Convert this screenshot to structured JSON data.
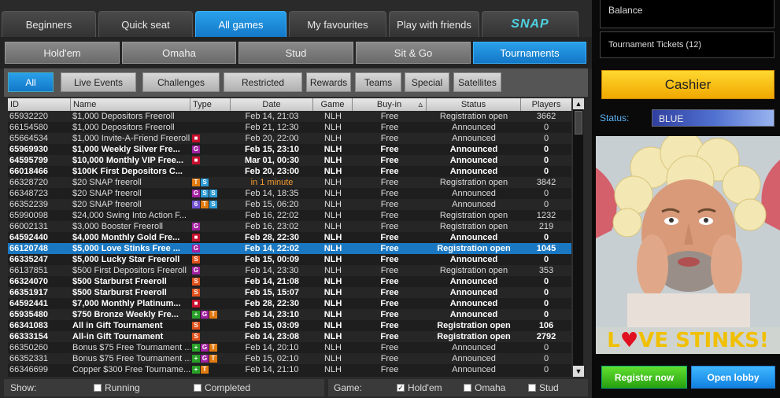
{
  "top_tabs": [
    {
      "label": "Beginners"
    },
    {
      "label": "Quick seat"
    },
    {
      "label": "All games"
    },
    {
      "label": "My favourites"
    },
    {
      "label": "Play with friends"
    },
    {
      "label": "SNAP"
    }
  ],
  "game_tabs": [
    {
      "label": "Hold'em"
    },
    {
      "label": "Omaha"
    },
    {
      "label": "Stud"
    },
    {
      "label": "Sit & Go"
    },
    {
      "label": "Tournaments"
    }
  ],
  "filter_tabs": [
    {
      "label": "All"
    },
    {
      "label": "Live Events"
    },
    {
      "label": "Challenges"
    },
    {
      "label": "Restricted"
    },
    {
      "label": "Rewards"
    },
    {
      "label": "Teams"
    },
    {
      "label": "Special"
    },
    {
      "label": "Satellites"
    }
  ],
  "table": {
    "headers": [
      "ID",
      "Name",
      "Type",
      "Date",
      "Game",
      "Buy-in",
      "Status",
      "Players"
    ],
    "rows": [
      {
        "id": "65932220",
        "name": "$1,000 Depositors Freeroll",
        "type": "",
        "date": "Feb 14, 21:03",
        "game": "NLH",
        "buyin": "Free",
        "status": "Registration open",
        "players": "3662",
        "style": ""
      },
      {
        "id": "66154580",
        "name": "$1,000 Depositors Freeroll",
        "type": "",
        "date": "Feb 21, 12:30",
        "game": "NLH",
        "buyin": "Free",
        "status": "Announced",
        "players": "0",
        "style": ""
      },
      {
        "id": "65664534",
        "name": "$1,000 Invite-A-Friend Freeroll",
        "type": "lock",
        "date": "Feb 20, 22:00",
        "game": "NLH",
        "buyin": "Free",
        "status": "Announced",
        "players": "0",
        "style": ""
      },
      {
        "id": "65969930",
        "name": "$1,000 Weekly Silver Fre...",
        "type": "G",
        "date": "Feb 15, 23:10",
        "game": "NLH",
        "buyin": "Free",
        "status": "Announced",
        "players": "0",
        "style": "bold"
      },
      {
        "id": "64595799",
        "name": "$10,000 Monthly VIP Free...",
        "type": "lock",
        "date": "Mar 01, 00:30",
        "game": "NLH",
        "buyin": "Free",
        "status": "Announced",
        "players": "0",
        "style": "bold"
      },
      {
        "id": "66018466",
        "name": "$100K First Depositors C...",
        "type": "",
        "date": "Feb 20, 23:00",
        "game": "NLH",
        "buyin": "Free",
        "status": "Announced",
        "players": "0",
        "style": "bold"
      },
      {
        "id": "66328720",
        "name": "$20 SNAP freeroll",
        "type": "T S",
        "date": "in 1 minute",
        "game": "NLH",
        "buyin": "Free",
        "status": "Registration open",
        "players": "3842",
        "style": "",
        "date_style": "orange"
      },
      {
        "id": "66348723",
        "name": "$20 SNAP freeroll",
        "type": "G S S",
        "date": "Feb 14, 18:35",
        "game": "NLH",
        "buyin": "Free",
        "status": "Announced",
        "players": "0",
        "style": ""
      },
      {
        "id": "66352239",
        "name": "$20 SNAP freeroll",
        "type": "6 T S",
        "date": "Feb 15, 06:20",
        "game": "NLH",
        "buyin": "Free",
        "status": "Announced",
        "players": "0",
        "style": ""
      },
      {
        "id": "65990098",
        "name": "$24,000 Swing Into Action F...",
        "type": "",
        "date": "Feb 16, 22:02",
        "game": "NLH",
        "buyin": "Free",
        "status": "Registration open",
        "players": "1232",
        "style": ""
      },
      {
        "id": "66002131",
        "name": "$3,000 Booster Freeroll",
        "type": "G",
        "date": "Feb 16, 23:02",
        "game": "NLH",
        "buyin": "Free",
        "status": "Registration open",
        "players": "219",
        "style": ""
      },
      {
        "id": "64592440",
        "name": "$4,000 Monthly Gold Fre...",
        "type": "lock",
        "date": "Feb 28, 22:30",
        "game": "NLH",
        "buyin": "Free",
        "status": "Announced",
        "players": "0",
        "style": "bold"
      },
      {
        "id": "66120748",
        "name": "$5,000 Love Stinks Free ...",
        "type": "G",
        "date": "Feb 14, 22:02",
        "game": "NLH",
        "buyin": "Free",
        "status": "Registration open",
        "players": "1045",
        "style": "sel"
      },
      {
        "id": "66335247",
        "name": "$5,000 Lucky Star Freeroll",
        "type": "ST",
        "date": "Feb 15, 00:09",
        "game": "NLH",
        "buyin": "Free",
        "status": "Announced",
        "players": "0",
        "style": "bold"
      },
      {
        "id": "66137851",
        "name": "$500 First Depositors Freeroll",
        "type": "G",
        "date": "Feb 14, 23:30",
        "game": "NLH",
        "buyin": "Free",
        "status": "Registration open",
        "players": "353",
        "style": ""
      },
      {
        "id": "66324070",
        "name": "$500 Starburst Freeroll",
        "type": "ST",
        "date": "Feb 14, 21:08",
        "game": "NLH",
        "buyin": "Free",
        "status": "Announced",
        "players": "0",
        "style": "bold"
      },
      {
        "id": "66351917",
        "name": "$500 Starburst Freeroll",
        "type": "ST",
        "date": "Feb 15, 15:07",
        "game": "NLH",
        "buyin": "Free",
        "status": "Announced",
        "players": "0",
        "style": "bold"
      },
      {
        "id": "64592441",
        "name": "$7,000 Monthly Platinum...",
        "type": "lock",
        "date": "Feb 28, 22:30",
        "game": "NLH",
        "buyin": "Free",
        "status": "Announced",
        "players": "0",
        "style": "bold"
      },
      {
        "id": "65935480",
        "name": "$750 Bronze Weekly Fre...",
        "type": "+ G T",
        "date": "Feb 14, 23:10",
        "game": "NLH",
        "buyin": "Free",
        "status": "Announced",
        "players": "0",
        "style": "bold"
      },
      {
        "id": "66341083",
        "name": "All in Gift Tournament",
        "type": "ST",
        "date": "Feb 15, 03:09",
        "game": "NLH",
        "buyin": "Free",
        "status": "Registration open",
        "players": "106",
        "style": "bold"
      },
      {
        "id": "66333154",
        "name": "All-in Gift Tournament",
        "type": "ST",
        "date": "Feb 14, 23:08",
        "game": "NLH",
        "buyin": "Free",
        "status": "Registration open",
        "players": "2792",
        "style": "bold"
      },
      {
        "id": "66350260",
        "name": "Bonus $75 Free Tournament ...",
        "type": "+ G T",
        "date": "Feb 14, 20:10",
        "game": "NLH",
        "buyin": "Free",
        "status": "Announced",
        "players": "0",
        "style": ""
      },
      {
        "id": "66352331",
        "name": "Bonus $75 Free Tournament ...",
        "type": "+ G T",
        "date": "Feb 15, 02:10",
        "game": "NLH",
        "buyin": "Free",
        "status": "Announced",
        "players": "0",
        "style": ""
      },
      {
        "id": "66346699",
        "name": "Copper $300 Free Tourname...",
        "type": "+ T",
        "date": "Feb 14, 21:10",
        "game": "NLH",
        "buyin": "Free",
        "status": "Announced",
        "players": "0",
        "style": ""
      }
    ]
  },
  "bottom": {
    "show_label": "Show:",
    "running_label": "Running",
    "completed_label": "Completed",
    "game_label": "Game:",
    "holdem_label": "Hold'em",
    "omaha_label": "Omaha",
    "stud_label": "Stud"
  },
  "sidebar": {
    "balance_label": "Balance",
    "tickets_label": "Tournament Tickets (12)",
    "cashier_label": "Cashier",
    "status_label": "Status:",
    "status_value": "BLUE",
    "ad_text_1": "L",
    "ad_text_2": "VE STINKS!",
    "register_label": "Register now",
    "lobby_label": "Open lobby"
  }
}
